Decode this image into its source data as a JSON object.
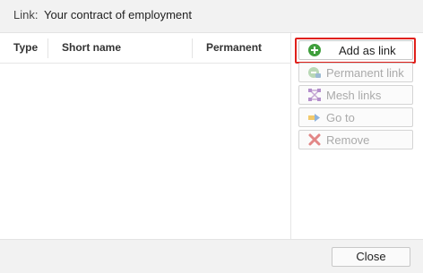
{
  "header": {
    "label": "Link:",
    "value": "Your contract of employment"
  },
  "table": {
    "columns": [
      "Type",
      "Short name",
      "Permanent"
    ]
  },
  "actions": [
    {
      "label": "Add as link",
      "icon": "add-circle-icon",
      "enabled": true,
      "highlighted": true
    },
    {
      "label": "Permanent link",
      "icon": "permanent-link-icon",
      "enabled": false
    },
    {
      "label": "Mesh links",
      "icon": "mesh-links-icon",
      "enabled": false
    },
    {
      "label": "Go to",
      "icon": "go-to-icon",
      "enabled": false
    },
    {
      "label": "Remove",
      "icon": "remove-x-icon",
      "enabled": false
    }
  ],
  "footer": {
    "close_label": "Close"
  },
  "colors": {
    "highlight": "#e0201b",
    "add_icon": "#3f9f3c",
    "remove_icon": "#e28686"
  }
}
